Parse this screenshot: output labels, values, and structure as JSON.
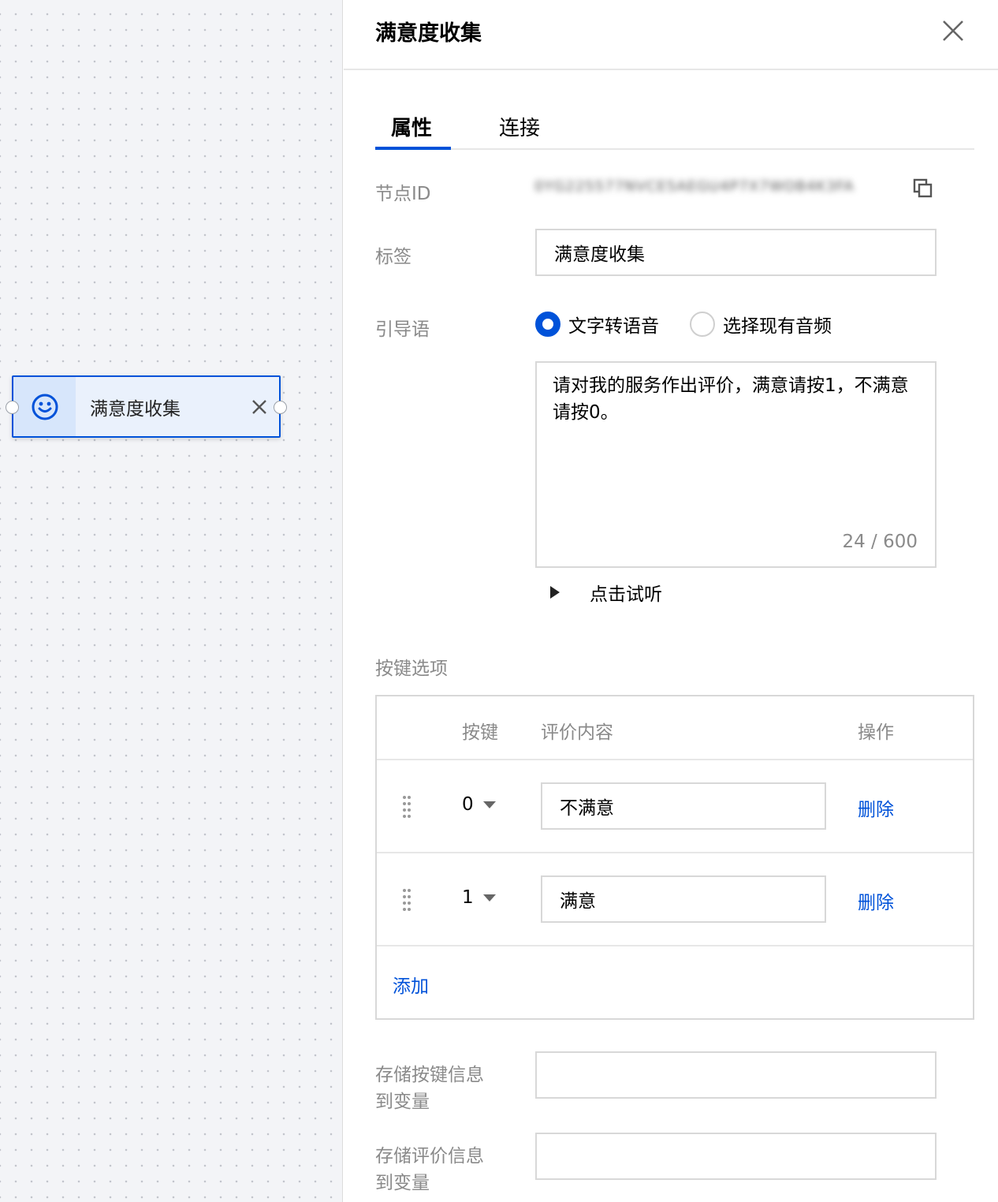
{
  "canvas": {
    "node": {
      "label": "满意度收集",
      "icon": "smiley-icon"
    }
  },
  "panel": {
    "title": "满意度收集",
    "tabs": [
      {
        "label": "属性",
        "active": true
      },
      {
        "label": "连接",
        "active": false
      }
    ],
    "fields": {
      "node_id_label": "节点ID",
      "node_id_value": "0YG225577NVCE5AEGU4P7X7WOB4K3FA",
      "tag_label": "标签",
      "tag_value": "满意度收集",
      "prompt_label": "引导语",
      "radio_tts": "文字转语音",
      "radio_audio": "选择现有音频",
      "prompt_text": "请对我的服务作出评价，满意请按1，不满意请按0。",
      "counter": "24 / 600",
      "preview_label": "点击试听"
    },
    "key_options": {
      "label": "按键选项",
      "headers": {
        "key": "按键",
        "content": "评价内容",
        "action": "操作"
      },
      "rows": [
        {
          "key": "0",
          "content": "不满意",
          "action": "删除"
        },
        {
          "key": "1",
          "content": "满意",
          "action": "删除"
        }
      ],
      "add_label": "添加"
    },
    "store_key_label": "存储按键信息到变量",
    "store_key_line1": "存储按键信息",
    "store_key_line2": "到变量",
    "store_eval_line1": "存储评价信息",
    "store_eval_line2": "到变量",
    "store_key_value": "",
    "store_eval_value": ""
  },
  "colors": {
    "accent": "#0052d9",
    "node_bg": "#eaf1fc",
    "muted": "#8a8a8a"
  }
}
